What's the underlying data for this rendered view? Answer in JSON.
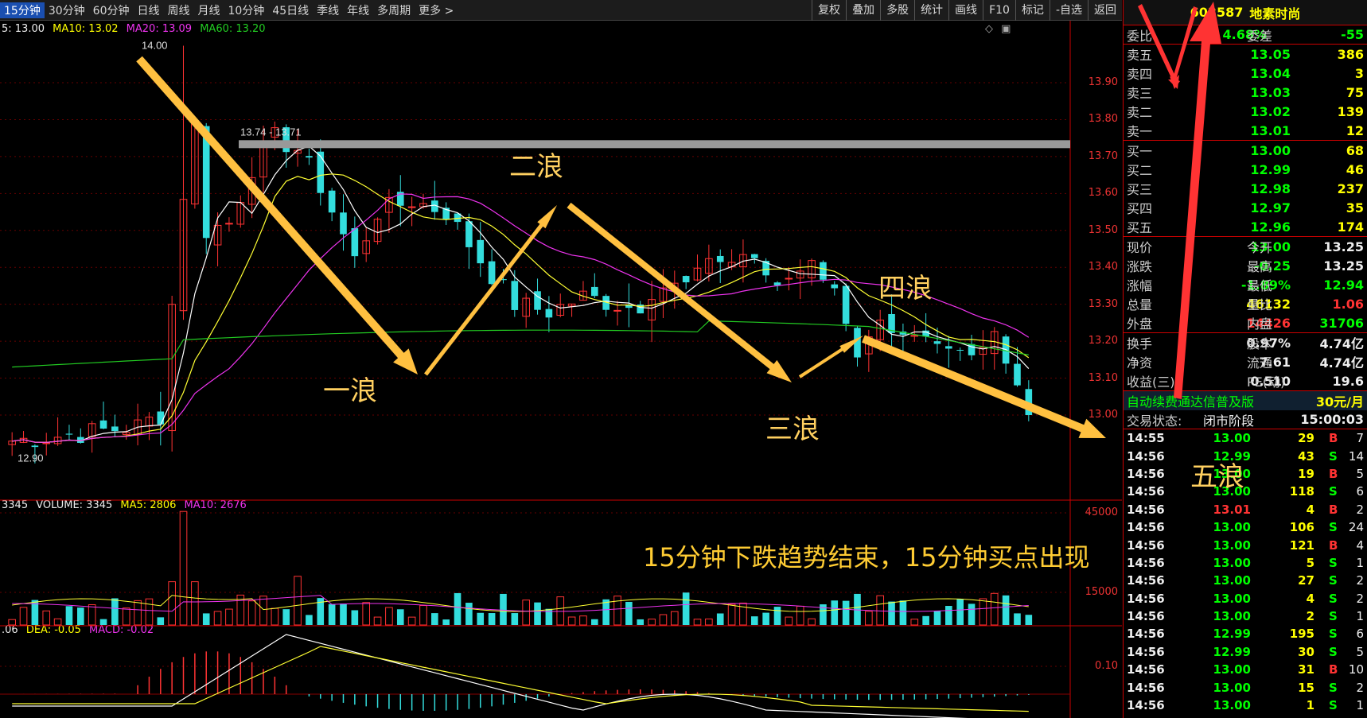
{
  "toolbar": {
    "left": [
      "15分钟",
      "30分钟",
      "60分钟",
      "日线",
      "周线",
      "月线",
      "10分钟",
      "45日线",
      "季线",
      "年线",
      "多周期",
      "更多 >"
    ],
    "right": [
      "复权",
      "叠加",
      "多股",
      "统计",
      "画线",
      "F10",
      "标记",
      "-自选",
      "返回"
    ]
  },
  "price_legend": {
    "ma5": "5: 13.00",
    "ma10": "MA10: 13.02",
    "ma20": "MA20: 13.09",
    "ma60": "MA60: 13.20"
  },
  "price_axis": [
    "13.90",
    "13.80",
    "13.70",
    "13.60",
    "13.50",
    "13.40",
    "13.30",
    "13.20",
    "13.10",
    "13.00"
  ],
  "hi_label": "14.00",
  "lo_label": "12.90",
  "range_label": "13.74 - 13.71",
  "vol_legend": {
    "a": "3345",
    "vol": "VOLUME: 3345",
    "ma5": "MA5: 2806",
    "ma10": "MA10: 2676"
  },
  "vol_axis": [
    "45000",
    "15000"
  ],
  "macd_legend": {
    "dif": ".06",
    "dea": "DEA: -0.05",
    "macd": "MACD: -0.02"
  },
  "macd_axis": [
    "0.10"
  ],
  "waves": {
    "w1": "一浪",
    "w2": "二浪",
    "w3": "三浪",
    "w4": "四浪",
    "w5": "五浪"
  },
  "note": "15分钟下跌趋势结束，15分钟买点出现",
  "panel": {
    "code": "603587",
    "name": "地素时尚",
    "wb": {
      "l1": "委比",
      "v1": "4.68%",
      "l2": "委差",
      "v2": "-55"
    },
    "asks": [
      {
        "label": "卖五",
        "price": "13.05",
        "vol": "386"
      },
      {
        "label": "卖四",
        "price": "13.04",
        "vol": "3"
      },
      {
        "label": "卖三",
        "price": "13.03",
        "vol": "75"
      },
      {
        "label": "卖二",
        "price": "13.02",
        "vol": "139"
      },
      {
        "label": "卖一",
        "price": "13.01",
        "vol": "12"
      }
    ],
    "bids": [
      {
        "label": "买一",
        "price": "13.00",
        "vol": "68"
      },
      {
        "label": "买二",
        "price": "12.99",
        "vol": "46"
      },
      {
        "label": "买三",
        "price": "12.98",
        "vol": "237"
      },
      {
        "label": "买四",
        "price": "12.97",
        "vol": "35"
      },
      {
        "label": "买五",
        "price": "12.96",
        "vol": "174"
      }
    ],
    "stats": [
      {
        "l1": "现价",
        "v1": "13.00",
        "c1": "green",
        "l2": "今开",
        "v2": "13.25",
        "c2": "white"
      },
      {
        "l1": "涨跌",
        "v1": "-0.25",
        "c1": "green",
        "l2": "最高",
        "v2": "13.25",
        "c2": "white"
      },
      {
        "l1": "涨幅",
        "v1": "-1.89%",
        "c1": "green",
        "l2": "最低",
        "v2": "12.94",
        "c2": "green"
      },
      {
        "l1": "总量",
        "v1": "46132",
        "c1": "yellow",
        "l2": "量比",
        "v2": "1.06",
        "c2": "red"
      },
      {
        "l1": "外盘",
        "v1": "14426",
        "c1": "red",
        "l2": "内盘",
        "v2": "31706",
        "c2": "green"
      }
    ],
    "stats2": [
      {
        "l1": "换手",
        "v1": "0.97%",
        "l2": "股本",
        "v2": "4.74亿"
      },
      {
        "l1": "净资",
        "v1": "7.61",
        "l2": "流通",
        "v2": "4.74亿"
      },
      {
        "l1": "收益(三)",
        "v1": "0.510",
        "l2": "PE(动)",
        "v2": "19.6"
      }
    ],
    "promo": "自动续费通达信普及版",
    "promo_price": "30元/月",
    "status_label": "交易状态:",
    "status": "闭市阶段",
    "status_time": "15:00:03",
    "ticks": [
      {
        "t": "14:55",
        "p": "13.00",
        "v": "29",
        "bs": "B",
        "n": "7"
      },
      {
        "t": "14:56",
        "p": "12.99",
        "v": "43",
        "bs": "S",
        "n": "14"
      },
      {
        "t": "14:56",
        "p": "13.00",
        "v": "19",
        "bs": "B",
        "n": "5"
      },
      {
        "t": "14:56",
        "p": "13.00",
        "v": "118",
        "bs": "S",
        "n": "6"
      },
      {
        "t": "14:56",
        "p": "13.01",
        "v": "4",
        "bs": "B",
        "n": "2"
      },
      {
        "t": "14:56",
        "p": "13.00",
        "v": "106",
        "bs": "S",
        "n": "24"
      },
      {
        "t": "14:56",
        "p": "13.00",
        "v": "121",
        "bs": "B",
        "n": "4"
      },
      {
        "t": "14:56",
        "p": "13.00",
        "v": "5",
        "bs": "S",
        "n": "1"
      },
      {
        "t": "14:56",
        "p": "13.00",
        "v": "27",
        "bs": "S",
        "n": "2"
      },
      {
        "t": "14:56",
        "p": "13.00",
        "v": "4",
        "bs": "S",
        "n": "2"
      },
      {
        "t": "14:56",
        "p": "13.00",
        "v": "2",
        "bs": "S",
        "n": "1"
      },
      {
        "t": "14:56",
        "p": "12.99",
        "v": "195",
        "bs": "S",
        "n": "6"
      },
      {
        "t": "14:56",
        "p": "12.99",
        "v": "30",
        "bs": "S",
        "n": "5"
      },
      {
        "t": "14:56",
        "p": "13.00",
        "v": "31",
        "bs": "B",
        "n": "10"
      },
      {
        "t": "14:56",
        "p": "13.00",
        "v": "15",
        "bs": "S",
        "n": "2"
      },
      {
        "t": "14:56",
        "p": "13.00",
        "v": "1",
        "bs": "S",
        "n": "1"
      }
    ]
  },
  "colors": {
    "up": "#ff3333",
    "down": "#33dddd",
    "ma5": "#ffffff",
    "ma10": "#ffff33",
    "ma20": "#ee33ee",
    "ma60": "#22cc22",
    "arrow": "#ffc040"
  }
}
